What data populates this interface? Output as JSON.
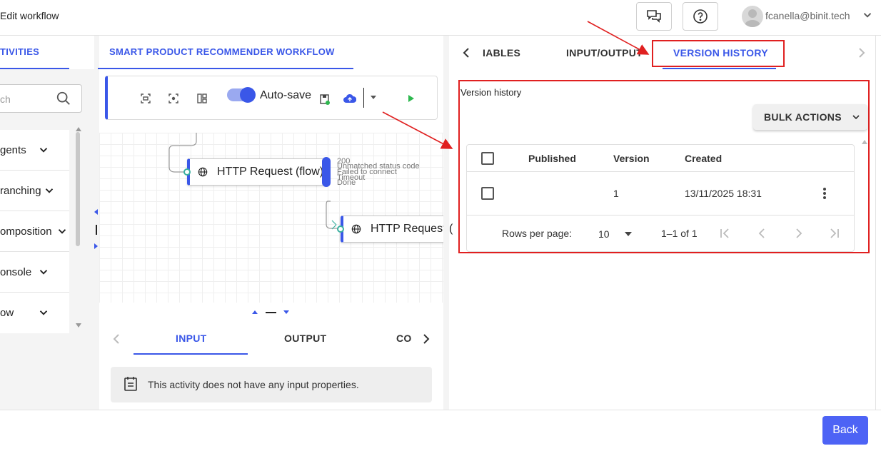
{
  "header": {
    "title": "Edit workflow",
    "user_email": "fcanella@binit.tech"
  },
  "left_panel": {
    "tab_label": "TIVITIES",
    "search_placeholder": "ch",
    "categories": [
      {
        "label": "gents"
      },
      {
        "label": "ranching"
      },
      {
        "label": "omposition"
      },
      {
        "label": "onsole"
      },
      {
        "label": "ow"
      }
    ]
  },
  "workflow": {
    "tab_label": "SMART PRODUCT RECOMMENDER WORKFLOW",
    "autosave_label": "Auto-save",
    "autosave_enabled": true,
    "nodes": [
      {
        "label": "HTTP Request (flow)"
      },
      {
        "label": "HTTP Request ("
      }
    ],
    "outcomes": [
      "200",
      "Unmatched status code",
      "Failed to connect",
      "Timeout",
      "Done"
    ],
    "bottom_tabs": [
      "INPUT",
      "OUTPUT",
      "CO"
    ],
    "active_bottom_tab": "INPUT",
    "info_message": "This activity does not have any input properties."
  },
  "right_panel": {
    "tabs": [
      "IABLES",
      "INPUT/OUTPUT",
      "VERSION HISTORY"
    ],
    "active_tab": "VERSION HISTORY",
    "section_title": "Version history",
    "bulk_actions_label": "BULK ACTIONS",
    "table": {
      "columns": [
        "Published",
        "Version",
        "Created"
      ],
      "rows": [
        {
          "published": "",
          "version": "1",
          "created": "13/11/2025 18:31"
        }
      ]
    },
    "pagination": {
      "rows_per_page_label": "Rows per page:",
      "rows_per_page": "10",
      "range": "1–1 of 1"
    }
  },
  "footer": {
    "back_label": "Back"
  },
  "colors": {
    "accent": "#3a57e8",
    "highlight": "#e02020",
    "button": "#4d63f5"
  }
}
